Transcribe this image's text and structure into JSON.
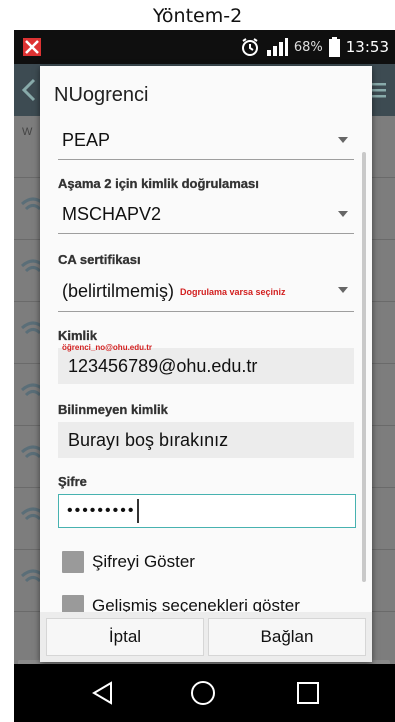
{
  "caption": "Yöntem-2",
  "status_bar": {
    "battery_percent": "68%",
    "time": "13:53"
  },
  "background": {
    "tab_hint": "W"
  },
  "dialog": {
    "title": "NUogrenci",
    "eap_method": {
      "value": "PEAP"
    },
    "phase2": {
      "label": "Aşama 2 için kimlik doğrulaması",
      "value": "MSCHAPV2"
    },
    "ca_cert": {
      "label": "CA sertifikası",
      "value": "(belirtilmemiş)",
      "hint": "Dogrulama varsa seçiniz"
    },
    "identity": {
      "label": "Kimlik",
      "hint": "öğrenci_no@ohu.edu.tr",
      "value": "123456789@ohu.edu.tr"
    },
    "anonymous_identity": {
      "label": "Bilinmeyen kimlik",
      "value": "Burayı boş bırakınız"
    },
    "password": {
      "label": "Şifre",
      "masked_value": "•••••••••"
    },
    "show_password": {
      "label": "Şifreyi Göster"
    },
    "advanced_options": {
      "label": "Gelişmiş seçenekleri göster"
    },
    "buttons": {
      "cancel": "İptal",
      "connect": "Bağlan"
    }
  }
}
